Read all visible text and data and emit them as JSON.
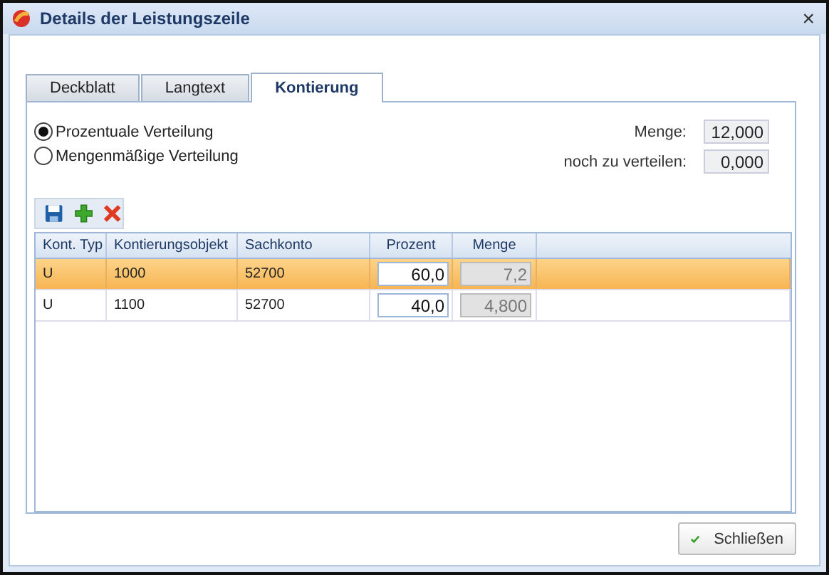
{
  "window": {
    "title": "Details der Leistungszeile",
    "close": "×"
  },
  "tabs": [
    {
      "label": "Deckblatt",
      "selected": false
    },
    {
      "label": "Langtext",
      "selected": false
    },
    {
      "label": "Kontierung",
      "selected": true
    }
  ],
  "distribution": [
    {
      "label": "Prozentuale Verteilung",
      "selected": true
    },
    {
      "label": "Mengenmäßige Verteilung",
      "selected": false
    }
  ],
  "totals": [
    {
      "label": "Menge:",
      "value": "12,000"
    },
    {
      "label": "noch zu verteilen:",
      "value": "0,000"
    }
  ],
  "table": {
    "columns": [
      "Kont. Typ",
      "Kontierungsobjekt",
      "Sachkonto",
      "Prozent",
      "Menge"
    ],
    "rows": [
      {
        "selected": true,
        "cells": [
          "U",
          "1000",
          "52700",
          "60,0",
          "7,2"
        ]
      },
      {
        "selected": false,
        "cells": [
          "U",
          "1100",
          "52700",
          "40,0",
          "4,800"
        ]
      }
    ]
  },
  "buttons": [
    {
      "label": "Schließen"
    }
  ]
}
